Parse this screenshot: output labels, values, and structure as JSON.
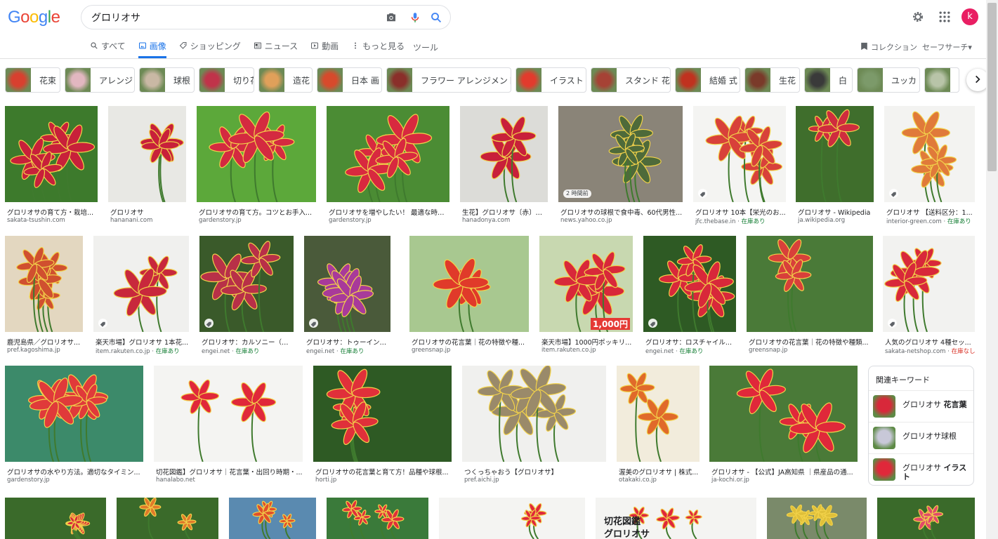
{
  "header": {
    "logo": [
      "G",
      "o",
      "o",
      "g",
      "l",
      "e"
    ],
    "logo_colors": [
      "#4285f4",
      "#ea4335",
      "#fbbc05",
      "#4285f4",
      "#34a853",
      "#ea4335"
    ],
    "query": "グロリオサ",
    "avatar_letter": "k"
  },
  "tabs": [
    {
      "label": "すべて",
      "icon": "search-icon",
      "active": false
    },
    {
      "label": "画像",
      "icon": "image-icon",
      "active": true
    },
    {
      "label": "ショッピング",
      "icon": "tag-icon",
      "active": false
    },
    {
      "label": "ニュース",
      "icon": "news-icon",
      "active": false
    },
    {
      "label": "動画",
      "icon": "play-icon",
      "active": false
    },
    {
      "label": "もっと見る",
      "icon": "more-icon",
      "active": false
    }
  ],
  "tools_label": "ツール",
  "collection_label": "コレクション",
  "safesearch_label": "セーフサーチ▾",
  "chips": [
    {
      "label": "花束",
      "color": "#d8402f"
    },
    {
      "label": "アレンジ",
      "color": "#e2b7c0"
    },
    {
      "label": "球根",
      "color": "#c9b8a4"
    },
    {
      "label": "切り花",
      "color": "#c0334a"
    },
    {
      "label": "造花",
      "color": "#e0a05a"
    },
    {
      "label": "日本 画",
      "color": "#d74a2c"
    },
    {
      "label": "フラワー アレンジメント",
      "color": "#8a2f2a"
    },
    {
      "label": "イラスト",
      "color": "#e23b2d"
    },
    {
      "label": "スタンド 花",
      "color": "#a64235"
    },
    {
      "label": "結婚 式",
      "color": "#c0321f"
    },
    {
      "label": "生花",
      "color": "#7a3a2a"
    },
    {
      "label": "白",
      "color": "#3a3a3a"
    },
    {
      "label": "ユッカ",
      "color": "#7c9a6a"
    },
    {
      "label": "",
      "color": "#b8c4a8"
    }
  ],
  "results": [
    {
      "caption": "グロリオサの育て方・栽培...",
      "source": "sakata-tsushin.com",
      "stock": "",
      "badge": "",
      "tag": false,
      "sale": "",
      "bg": [
        "#3d7a2c",
        "#c8203a"
      ]
    },
    {
      "caption": "グロリオサ",
      "source": "hananani.com",
      "stock": "",
      "badge": "",
      "tag": false,
      "sale": "",
      "bg": [
        "#e8e8e4",
        "#c8203a"
      ]
    },
    {
      "caption": "グロリオサの育て方。コツとお手入...",
      "source": "gardenstory.jp",
      "stock": "",
      "badge": "",
      "tag": false,
      "sale": "",
      "bg": [
        "#5ca83a",
        "#d42a40"
      ]
    },
    {
      "caption": "グロリオサを増やしたい！ 最適な時期...",
      "source": "gardenstory.jp",
      "stock": "",
      "badge": "",
      "tag": false,
      "sale": "",
      "bg": [
        "#4b8c34",
        "#d8293f"
      ]
    },
    {
      "caption": "生花】グロリオサ〔赤〕秀...",
      "source": "hanadonya.com",
      "stock": "",
      "badge": "",
      "tag": false,
      "sale": "",
      "bg": [
        "#dcdcd8",
        "#c8203a"
      ]
    },
    {
      "caption": "グロリオサの球根で食中毒、60代男性...",
      "source": "news.yahoo.co.jp",
      "stock": "",
      "badge": "2 時間前",
      "tag": false,
      "sale": "",
      "bg": [
        "#8a8478",
        "#4e6a3a"
      ]
    },
    {
      "caption": "グロリオサ 10本【栄光のお...",
      "source": "jfc.thebase.in · ",
      "stock": "在庫あり",
      "stock_class": "ok",
      "badge": "",
      "tag": true,
      "sale": "",
      "bg": [
        "#f4f4f2",
        "#d8413a"
      ]
    },
    {
      "caption": "グロリオサ - Wikipedia",
      "source": "ja.wikipedia.org",
      "stock": "",
      "badge": "",
      "tag": false,
      "sale": "",
      "bg": [
        "#3f6e2c",
        "#cf2c3e"
      ]
    },
    {
      "caption": "グロリオサ 【送料区分：1...",
      "source": "interior-green.com · ",
      "stock": "在庫あり",
      "stock_class": "ok",
      "badge": "",
      "tag": true,
      "sale": "",
      "bg": [
        "#f3f3f1",
        "#e07a3a"
      ]
    },
    {
      "caption": "鹿児島県／グロリオサ...",
      "source": "pref.kagoshima.jp",
      "stock": "",
      "badge": "",
      "tag": false,
      "sale": "",
      "bg": [
        "#e3d7c0",
        "#d0502f"
      ]
    },
    {
      "caption": "楽天市場】グロリオサ 1本花...",
      "source": "item.rakuten.co.jp · ",
      "stock": "在庫あり",
      "stock_class": "ok",
      "badge": "",
      "tag": true,
      "sale": "",
      "bg": [
        "#f0f0ee",
        "#c8283c"
      ]
    },
    {
      "caption": "グロリオサ：カルソニー（赤...",
      "source": "engei.net · ",
      "stock": "在庫あり",
      "stock_class": "ok",
      "badge": "",
      "tag": true,
      "sale": "",
      "bg": [
        "#3a5a2a",
        "#b83048"
      ]
    },
    {
      "caption": "グロリオサ：トゥーインワン...",
      "source": "engei.net · ",
      "stock": "在庫あり",
      "stock_class": "ok",
      "badge": "",
      "tag": true,
      "sale": "",
      "bg": [
        "#4a5a3a",
        "#a83a9a"
      ]
    },
    {
      "caption": "グロリオサの花言葉｜花の特徴や種...",
      "source": "greensnap.jp",
      "stock": "",
      "badge": "",
      "tag": false,
      "sale": "",
      "bg": [
        "#a8c890",
        "#e03a2a"
      ]
    },
    {
      "caption": "楽天市場】1000円ポッキリ...",
      "source": "item.rakuten.co.jp",
      "stock": "",
      "badge": "",
      "tag": false,
      "sale": "1,000円",
      "bg": [
        "#c8d8b0",
        "#d8283a"
      ]
    },
    {
      "caption": "グロリオサ：ロスチャイル...",
      "source": "engei.net · ",
      "stock": "在庫あり",
      "stock_class": "ok",
      "badge": "",
      "tag": true,
      "sale": "",
      "bg": [
        "#2e5a24",
        "#d8283a"
      ]
    },
    {
      "caption": "グロリオサの花言葉｜花の特徴や種類...",
      "source": "greensnap.jp",
      "stock": "",
      "badge": "",
      "tag": false,
      "sale": "",
      "bg": [
        "#4a7a38",
        "#d8403a"
      ]
    },
    {
      "caption": "人気のグロリオサ 4種セッ...",
      "source": "sakata-netshop.com · ",
      "stock": "在庫なし",
      "stock_class": "no",
      "badge": "",
      "tag": true,
      "sale": "",
      "bg": [
        "#f2f2f0",
        "#d8283a"
      ]
    },
    {
      "caption": "グロリオサの水やり方法。適切なタイミン...",
      "source": "gardenstory.jp",
      "stock": "",
      "badge": "",
      "tag": false,
      "sale": "",
      "bg": [
        "#3c8a6a",
        "#e03a3a"
      ]
    },
    {
      "caption": "切花図鑑】グロリオサ｜花言葉・出回り時期・...",
      "source": "hanalabo.net",
      "stock": "",
      "badge": "",
      "tag": false,
      "sale": "",
      "bg": [
        "#f4f4f2",
        "#e0283a"
      ]
    },
    {
      "caption": "グロリオサの花言葉と育て方！品種や球根...",
      "source": "horti.jp",
      "stock": "",
      "badge": "",
      "tag": false,
      "sale": "",
      "bg": [
        "#2e5a24",
        "#e0303a"
      ]
    },
    {
      "caption": "つくっちゃおう【グロリオサ】",
      "source": "pref.aichi.jp",
      "stock": "",
      "badge": "",
      "tag": false,
      "sale": "",
      "bg": [
        "#f0f0ee",
        "#9a8a6a"
      ]
    },
    {
      "caption": "渥美のグロリオサ | 株式...",
      "source": "otakaki.co.jp",
      "stock": "",
      "badge": "",
      "tag": false,
      "sale": "",
      "bg": [
        "#f2ecdc",
        "#e06a2a"
      ]
    },
    {
      "caption": "グロリオサ - 【公式】JA高知県 ｜県産品の通...",
      "source": "ja-kochi.or.jp",
      "stock": "",
      "badge": "",
      "tag": false,
      "sale": "",
      "bg": [
        "#4a7a38",
        "#e0283a"
      ]
    },
    {
      "caption": "",
      "source": "",
      "stock": "",
      "badge": "",
      "tag": false,
      "sale": "",
      "bg": [
        "#3a6a2a",
        "#d8283a"
      ]
    },
    {
      "caption": "",
      "source": "",
      "stock": "",
      "badge": "",
      "tag": false,
      "sale": "",
      "bg": [
        "#3a6a2a",
        "#e07a2a"
      ]
    },
    {
      "caption": "",
      "source": "",
      "stock": "",
      "badge": "",
      "tag": false,
      "sale": "",
      "bg": [
        "#5a8ab0",
        "#e0502a"
      ]
    },
    {
      "caption": "",
      "source": "",
      "stock": "",
      "badge": "",
      "tag": false,
      "sale": "",
      "bg": [
        "#3a7a3a",
        "#e0303a"
      ]
    },
    {
      "caption": "",
      "source": "",
      "stock": "",
      "badge": "",
      "tag": false,
      "sale": "",
      "bg": [
        "#f4f4f2",
        "#e0283a"
      ]
    },
    {
      "caption": "切花図鑑\nグロリオサ",
      "source": "",
      "stock": "",
      "badge": "",
      "tag": false,
      "sale": "",
      "bg": [
        "#f4f4f2",
        "#e0283a"
      ],
      "overlay": true
    },
    {
      "caption": "",
      "source": "",
      "stock": "",
      "badge": "",
      "tag": false,
      "sale": "",
      "bg": [
        "#7a8a6a",
        "#e0c03a"
      ]
    },
    {
      "caption": "",
      "source": "",
      "stock": "",
      "badge": "",
      "tag": false,
      "sale": "",
      "bg": [
        "#3a6a2a",
        "#e04a6a"
      ]
    }
  ],
  "related": {
    "title": "関連キーワード",
    "items": [
      {
        "pre": "グロリオサ ",
        "bold": "花言葉",
        "color": "#d8283a"
      },
      {
        "pre": "グロリオサ球根",
        "bold": "",
        "color": "#c8c8d8"
      },
      {
        "pre": "グロリオサ ",
        "bold": "イラスト",
        "color": "#e0283a"
      }
    ]
  }
}
